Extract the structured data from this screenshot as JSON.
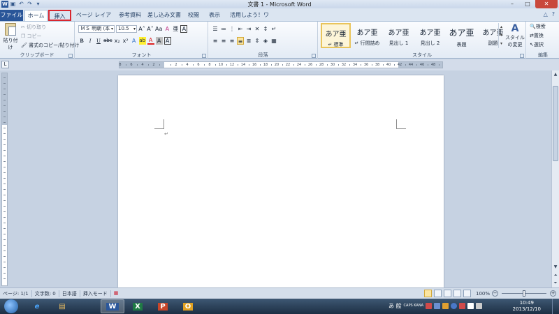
{
  "window": {
    "title": "文書 1 - Microsoft Word",
    "app_logo": "W",
    "controls": {
      "minimize": "–",
      "maximize": "□",
      "close": "✕"
    }
  },
  "tabs": [
    {
      "label": "ファイル"
    },
    {
      "label": "ホーム"
    },
    {
      "label": "挿入"
    },
    {
      "label": "ページ レイアウト"
    },
    {
      "label": "参考資料"
    },
    {
      "label": "差し込み文書"
    },
    {
      "label": "校閲"
    },
    {
      "label": "表示"
    },
    {
      "label": "活用しよう！ワード"
    }
  ],
  "ribbon": {
    "clipboard": {
      "label": "クリップボード",
      "paste": "貼り付け",
      "cut": "切り取り",
      "copy": "コピー",
      "format_painter": "書式のコピー/貼り付け"
    },
    "font": {
      "label": "フォント",
      "font_name": "ＭＳ 明朝 (本",
      "font_size": "10.5",
      "grow": "A˄",
      "shrink": "A˅",
      "case": "Aa",
      "clear": "A",
      "phonetic": "亜",
      "enclose": "A",
      "bold": "B",
      "italic": "I",
      "underline": "U",
      "strike": "abc",
      "subscript": "x₂",
      "superscript": "x²",
      "effects": "A",
      "highlight": "ab",
      "font_color": "A",
      "char_shade": "A",
      "char_border": "A"
    },
    "paragraph": {
      "label": "段落"
    },
    "styles": {
      "label": "スタイル",
      "items": [
        {
          "sample": "あア亜",
          "name": "↵ 標準"
        },
        {
          "sample": "あア亜",
          "name": "↵ 行間詰め"
        },
        {
          "sample": "あア亜",
          "name": "見出し 1"
        },
        {
          "sample": "あア亜",
          "name": "見出し 2"
        },
        {
          "sample": "あア亜",
          "name": "表題"
        },
        {
          "sample": "あア亜",
          "name": "副題"
        }
      ],
      "change": "スタイルの変更"
    },
    "editing": {
      "label": "編集",
      "find": "検索",
      "replace": "置換",
      "select": "選択"
    }
  },
  "ruler": {
    "numbers": [
      "8",
      "6",
      "4",
      "2",
      "",
      "2",
      "4",
      "6",
      "8",
      "10",
      "12",
      "14",
      "16",
      "18",
      "20",
      "22",
      "24",
      "26",
      "28",
      "30",
      "32",
      "34",
      "36",
      "38",
      "40",
      "42",
      "44",
      "46",
      "48"
    ]
  },
  "document": {
    "paragraph_mark": "↵"
  },
  "status": {
    "page": "ページ: 1/1",
    "words": "文字数: 0",
    "language": "日本語",
    "mode": "挿入モード",
    "zoom": "100%"
  },
  "taskbar": {
    "apps": [
      {
        "label": "e",
        "name": "internet-explorer",
        "color": "#4aa6ff"
      },
      {
        "label": "▤",
        "name": "explorer",
        "color": "#f0c060"
      },
      {
        "label": "W",
        "name": "word",
        "color": "#2b579a"
      },
      {
        "label": "X",
        "name": "excel",
        "color": "#1f7b44"
      },
      {
        "label": "P",
        "name": "powerpoint",
        "color": "#c8462a"
      },
      {
        "label": "O",
        "name": "outlook",
        "color": "#e0a020"
      }
    ],
    "ime": "あ 般",
    "caps": "CAPS KANA",
    "time": "10:49",
    "date": "2013/12/10"
  },
  "colors": {
    "file_tab": "#2a5699",
    "highlight_box": "#d8262f",
    "active_style": "#e9c45b"
  }
}
